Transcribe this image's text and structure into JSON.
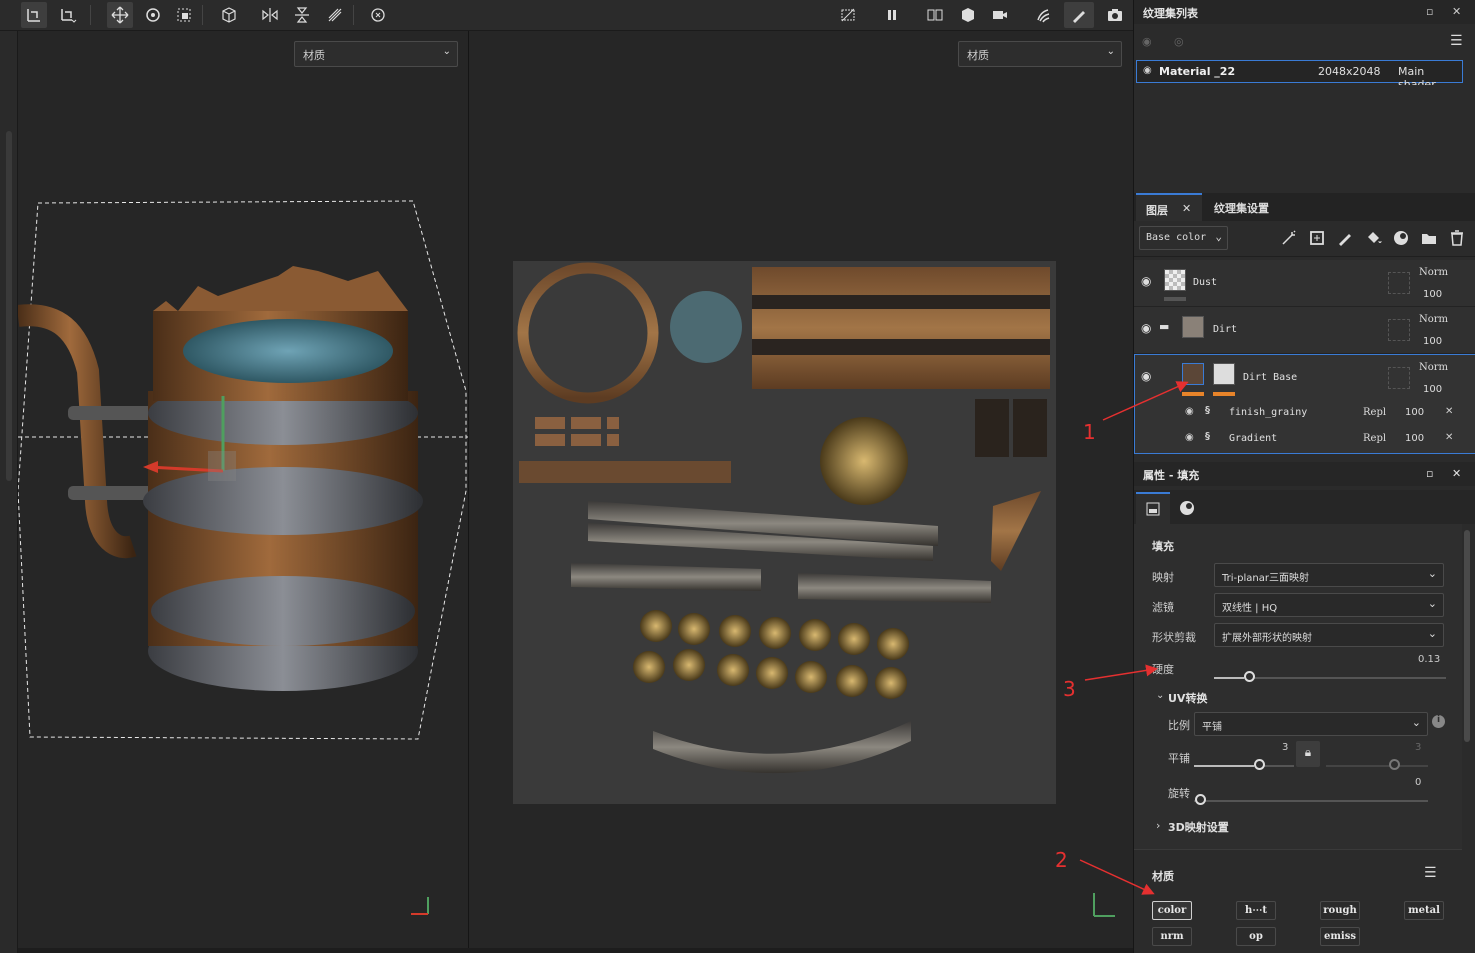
{
  "viewport": {
    "left_select": "材质",
    "right_select": "材质"
  },
  "texture_set_list": {
    "title": "纹理集列表",
    "material": {
      "name": "Material _22",
      "resolution": "2048x2048",
      "shader": "Main shader"
    }
  },
  "layers_panel": {
    "tab_layers": "图层",
    "tab_settings": "纹理集设置",
    "channel": "Base color",
    "layers": [
      {
        "name": "Dust",
        "blend": "Norm",
        "opacity": "100"
      },
      {
        "name": "Dirt",
        "blend": "Norm",
        "opacity": "100"
      },
      {
        "name": "Dirt Base",
        "blend": "Norm",
        "opacity": "100"
      }
    ],
    "effects": [
      {
        "name": "finish_grainy",
        "blend": "Repl",
        "opacity": "100"
      },
      {
        "name": "Gradient",
        "blend": "Repl",
        "opacity": "100"
      }
    ]
  },
  "properties": {
    "title": "属性 - 填充",
    "fill_section": "填充",
    "mapping_label": "映射",
    "mapping_value": "Tri-planar三面映射",
    "filter_label": "滤镜",
    "filter_value": "双线性 | HQ",
    "shape_label": "形状剪裁",
    "shape_value": "扩展外部形状的映射",
    "hardness_label": "硬度",
    "hardness_value": "0.13",
    "uv_section": "UV转换",
    "scale_label": "比例",
    "scale_value": "平铺",
    "tiling_label": "平铺",
    "tiling_u": "3",
    "tiling_v": "3",
    "rotation_label": "旋转",
    "rotation_value": "0",
    "projection_section": "3D映射设置",
    "material_section": "材质",
    "channels": [
      "color",
      "h⋯t",
      "rough",
      "metal",
      "nrm",
      "op",
      "emiss"
    ]
  },
  "annotations": [
    "1",
    "2",
    "3"
  ],
  "colors": {
    "accent": "#3a7bd5",
    "annotation": "#e53030",
    "orange": "#e8842a"
  }
}
